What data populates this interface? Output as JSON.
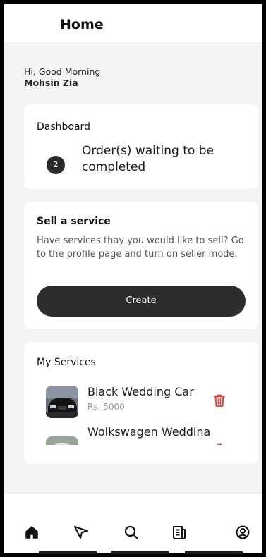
{
  "header": {
    "title": "Home"
  },
  "greeting": {
    "line1": "Hi, Good Morning",
    "name": "Mohsin Zia"
  },
  "dashboard": {
    "title": "Dashboard",
    "badge_count": "2",
    "text": "Order(s) waiting to be completed"
  },
  "sell": {
    "title": "Sell a service",
    "description": "Have services thay you would like to sell? Go to the profile page and turn on seller mode.",
    "button_label": "Create"
  },
  "services": {
    "title": "My Services",
    "items": [
      {
        "name": "Black Wedding Car",
        "price": "Rs. 5000"
      },
      {
        "name": "Wolkswagen Weddina",
        "price": ""
      }
    ]
  },
  "bottom_nav": {
    "items": [
      "home-icon",
      "send-icon",
      "search-icon",
      "orders-icon",
      "profile-icon"
    ]
  },
  "colors": {
    "accent_dark": "#2d2d2d",
    "delete_red": "#e53935",
    "background": "#f4f4f4"
  }
}
